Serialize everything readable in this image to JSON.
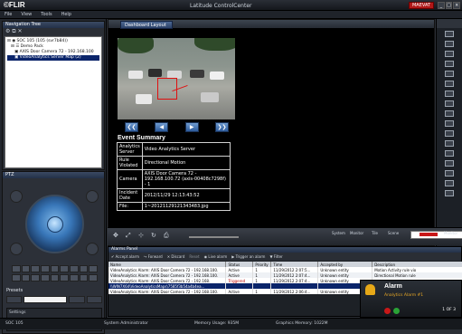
{
  "titlebar": {
    "logo": "©FLIR",
    "app_title": "Latitude ControlCenter",
    "user_badge": "MAEVAT"
  },
  "menu": [
    "File",
    "View",
    "Tools",
    "Help"
  ],
  "nav": {
    "title": "Navigation Tree",
    "tools": "⚙ ⧉ ✕",
    "items": [
      {
        "label": "⊟ ◉ SOC 105 (105 (svr7b84))",
        "indent": 0
      },
      {
        "label": "⊟ ☰ Demo Pack",
        "indent": 4
      },
      {
        "label": "▣ AXIS Door Camera 72 - 192.168.100",
        "indent": 8
      },
      {
        "label": "▣ VideoAnalytics Server Map (2)",
        "indent": 8,
        "selected": true
      }
    ]
  },
  "ptz": {
    "title": "PTZ",
    "presets_label": "Presets",
    "settings_label": "Settings"
  },
  "dashboard_tab": "Dashboard Layout",
  "video_controls": [
    "❮❮",
    "◀",
    "▶",
    "❯❯"
  ],
  "event_summary": {
    "title": "Event Summary",
    "rows": [
      {
        "key": "Analytics Server",
        "value": "Video Analytics Server"
      },
      {
        "key": "Rule Violated",
        "value": "Directional Motion"
      },
      {
        "key": "Camera",
        "value": "AXIS Door Camera 72 - 192.168.100.72 (axis-00408c7298f) - 1"
      },
      {
        "key": "Incident Date",
        "value": "2012/11/29 12:13:43:52"
      },
      {
        "key": "File:",
        "value": "1~20121129121343483.jpg"
      }
    ]
  },
  "controlstrip": {
    "labels": [
      "System",
      "Monitor",
      "Tile",
      "Scene"
    ],
    "monitor_label": "Monitor"
  },
  "alarm": {
    "title": "Alarms Panel",
    "tools": [
      {
        "label": "✔ Accept alarm",
        "disabled": false
      },
      {
        "label": "↪ Forward",
        "disabled": false
      },
      {
        "label": "✕ Discard",
        "disabled": false
      },
      {
        "label": "Reset",
        "disabled": true
      },
      {
        "label": "◉ Live alarm",
        "disabled": false
      },
      {
        "label": "▶ Trigger an alarm",
        "disabled": false
      },
      {
        "label": "▼ Filter",
        "disabled": false
      }
    ],
    "columns": [
      "Name",
      "Status",
      "Priority",
      "Time",
      "Accepted by",
      "Description"
    ],
    "rows": [
      {
        "name": "VideoAnalytics Alarm: AXIS Door Camera 72 - 192.168.100.",
        "status": "Active",
        "priority": "1",
        "time": "11/29/2012 2:07:5...",
        "accepted": "Unknown entity",
        "desc": "Motion Activity rule vio"
      },
      {
        "name": "VideoAnalytics Alarm: AXIS Door Camera 72 - 192.168.100.",
        "status": "Active",
        "priority": "1",
        "time": "11/29/2012 2:07:4...",
        "accepted": "Unknown entity",
        "desc": "Directional Motion rule"
      },
      {
        "name": "VideoAnalytics Alarm: AXIS Door Camera 72 - 192.168.",
        "status": "Triggered",
        "priority": "1",
        "time": "11/29/2012 2:07:4...",
        "accepted": "Unknown entity",
        "desc": ""
      },
      {
        "name": "\\\\WIN7X64\\VideoAnalyticsMaps\\7585f3b54a4b4ea...",
        "status": "",
        "priority": "",
        "time": "",
        "accepted": "",
        "desc": "",
        "selected": true
      },
      {
        "name": "VideoAnalytics Alarm: AXIS Door Camera 72 - 192.168.100.",
        "status": "Active",
        "priority": "1",
        "time": "11/29/2012 2:06:4...",
        "accepted": "Unknown entity",
        "desc": ""
      }
    ]
  },
  "notification": {
    "title": "Alarm",
    "subtitle": "Analytics Alarm #1",
    "count": "1 OF 3"
  },
  "statusbar": {
    "server": "SOC 105",
    "user": "System Administrator",
    "memory": "Memory Usage: 935M",
    "graphics": "Graphics Memory: 1022M"
  },
  "colors": {
    "accent": "#2b4168",
    "alarm_red": "#b01818",
    "bell": "#e6a817"
  }
}
